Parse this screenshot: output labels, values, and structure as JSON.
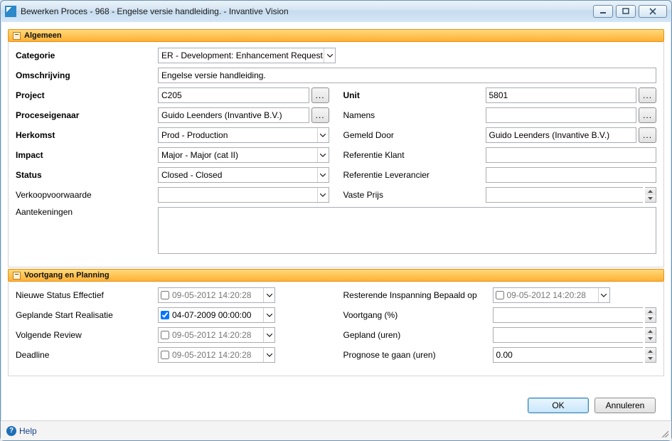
{
  "window": {
    "title": "Bewerken Proces - 968 - Engelse versie handleiding. - Invantive Vision"
  },
  "sections": {
    "algemeen": "Algemeen",
    "voortgang": "Voortgang en Planning"
  },
  "labels": {
    "categorie": "Categorie",
    "omschrijving": "Omschrijving",
    "project": "Project",
    "proceseigenaar": "Proceseigenaar",
    "herkomst": "Herkomst",
    "impact": "Impact",
    "status": "Status",
    "verkoopvoorwaarde": "Verkoopvoorwaarde",
    "aantekeningen": "Aantekeningen",
    "unit": "Unit",
    "namens": "Namens",
    "gemeld_door": "Gemeld Door",
    "referentie_klant": "Referentie Klant",
    "referentie_leverancier": "Referentie Leverancier",
    "vaste_prijs": "Vaste Prijs",
    "nieuwe_status": "Nieuwe Status Effectief",
    "geplande_start": "Geplande Start Realisatie",
    "volgende_review": "Volgende Review",
    "deadline": "Deadline",
    "resterende": "Resterende Inspanning Bepaald op",
    "voortgang_pct": "Voortgang (%)",
    "gepland_uren": "Gepland (uren)",
    "prognose": "Prognose te gaan (uren)"
  },
  "values": {
    "categorie": "ER - Development: Enhancement Request",
    "omschrijving": "Engelse versie handleiding.",
    "project": "C205",
    "proceseigenaar": "Guido Leenders (Invantive B.V.)",
    "herkomst": "Prod - Production",
    "impact": "Major - Major (cat II)",
    "status": "Closed - Closed",
    "verkoopvoorwaarde": "",
    "aantekeningen": "",
    "unit": "5801",
    "namens": "",
    "gemeld_door": "Guido Leenders (Invantive B.V.)",
    "referentie_klant": "",
    "referentie_leverancier": "",
    "vaste_prijs": "",
    "nieuwe_status": "09-05-2012 14:20:28",
    "geplande_start": "04-07-2009 00:00:00",
    "volgende_review": "09-05-2012 14:20:28",
    "deadline": "09-05-2012 14:20:28",
    "resterende": "09-05-2012 14:20:28",
    "voortgang_pct": "",
    "gepland_uren": "",
    "prognose": "0.00"
  },
  "buttons": {
    "ok": "OK",
    "annuleren": "Annuleren",
    "help": "Help"
  },
  "ellipsis": "..."
}
